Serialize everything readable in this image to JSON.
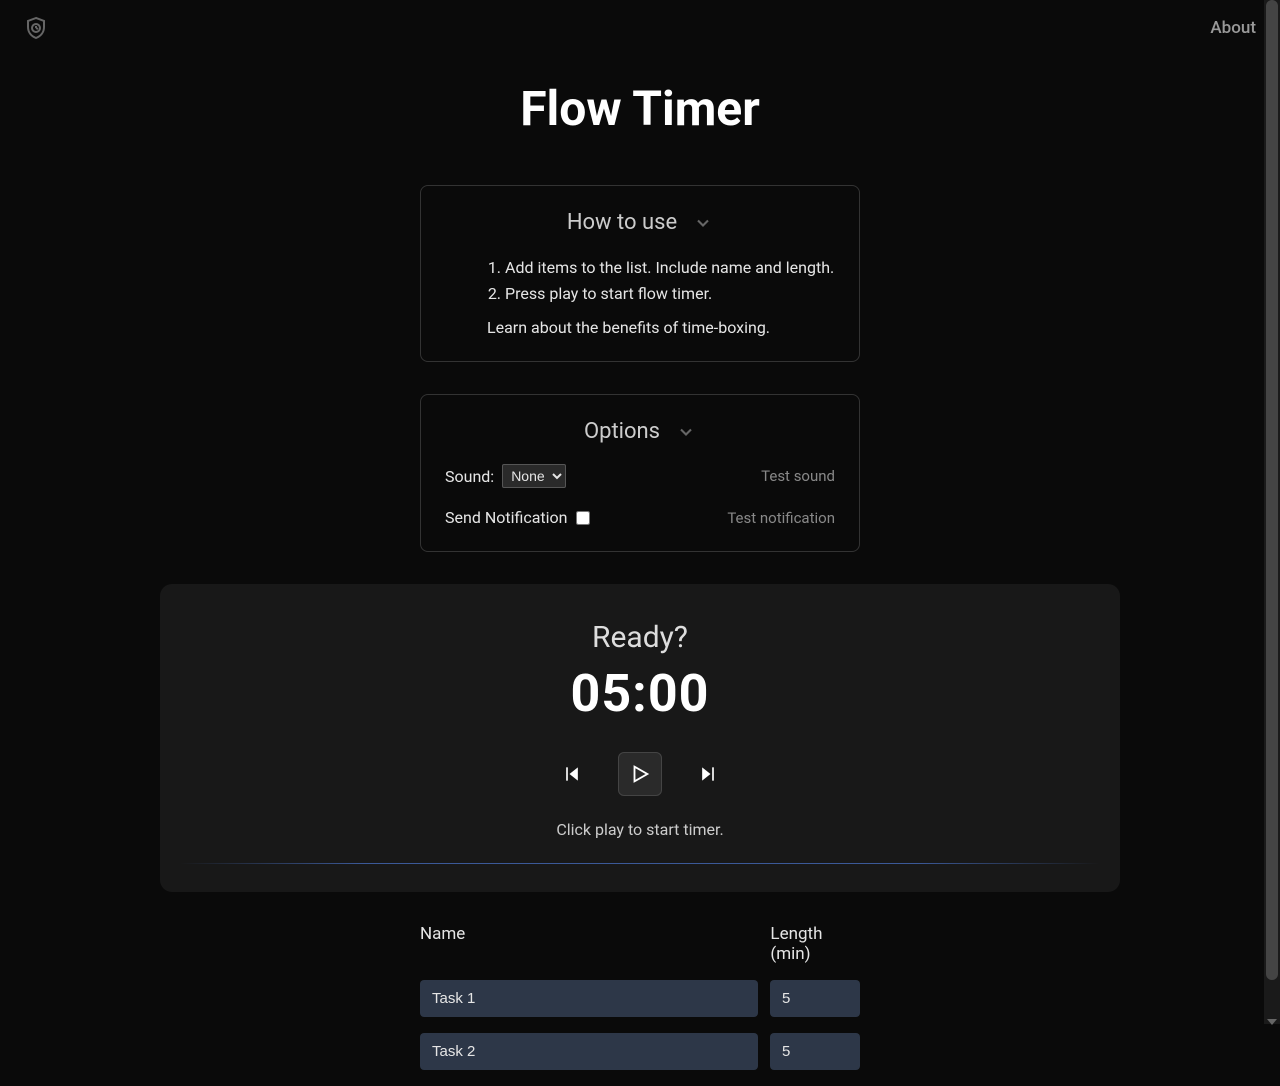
{
  "header": {
    "about_label": "About"
  },
  "title": "Flow Timer",
  "howto": {
    "title": "How to use",
    "step1": "Add items to the list. Include name and length.",
    "step2": "Press play to start flow timer.",
    "learn_more": "Learn about the benefits of time-boxing."
  },
  "options": {
    "title": "Options",
    "sound_label": "Sound:",
    "sound_value": "None",
    "test_sound": "Test sound",
    "notification_label": "Send Notification",
    "notification_checked": false,
    "test_notification": "Test notification"
  },
  "timer": {
    "status": "Ready?",
    "time": "05:00",
    "hint": "Click play to start timer."
  },
  "tasks": {
    "name_header": "Name",
    "length_header": "Length (min)",
    "rows": [
      {
        "name": "Task 1",
        "length": "5"
      },
      {
        "name": "Task 2",
        "length": "5"
      }
    ]
  }
}
